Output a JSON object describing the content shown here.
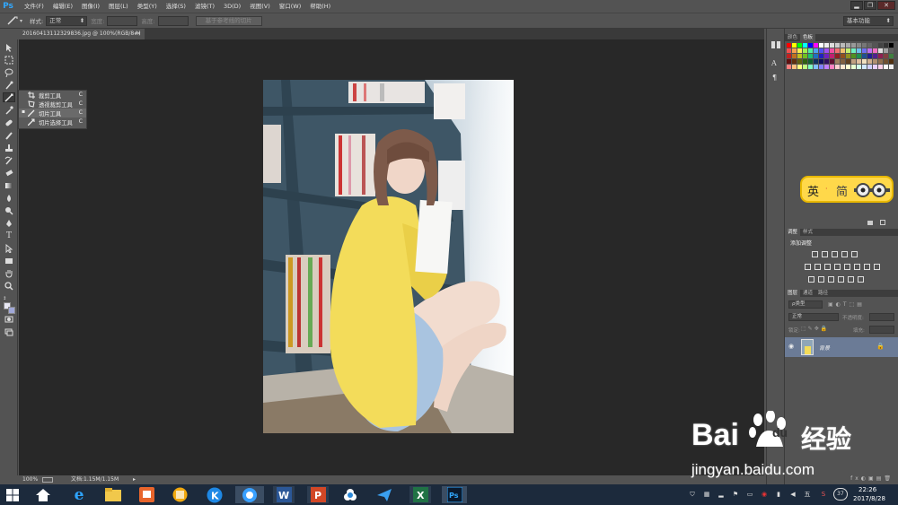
{
  "app": {
    "logo": "Ps"
  },
  "menu": [
    "文件(F)",
    "编辑(E)",
    "图像(I)",
    "图层(L)",
    "类型(Y)",
    "选择(S)",
    "滤镜(T)",
    "3D(D)",
    "视图(V)",
    "窗口(W)",
    "帮助(H)"
  ],
  "window_controls": {
    "minimize": "▂",
    "restore": "❐",
    "close": "✕"
  },
  "options": {
    "style_label": "样式:",
    "style_value": "正常",
    "width_label": "宽度:",
    "height_label": "高度:",
    "guides_button": "基于参考线的切片",
    "workspace": "基本功能"
  },
  "document": {
    "tab_title": "20160413112329836.jpg @ 100%(RGB/8#)",
    "tab_close": "×"
  },
  "flyout": {
    "items": [
      {
        "label": "裁剪工具",
        "key": "C"
      },
      {
        "label": "透视裁剪工具",
        "key": "C"
      },
      {
        "label": "切片工具",
        "key": "C"
      },
      {
        "label": "切片选择工具",
        "key": "C"
      }
    ]
  },
  "status": {
    "zoom": "100%",
    "doc": "文档:1.15M/1.15M"
  },
  "panels": {
    "swatch_tabs": [
      "颜色",
      "色板"
    ],
    "ime": {
      "lang": "英",
      "mode": "简",
      "sep": "·"
    },
    "adjust_tabs": [
      "调整",
      "样式"
    ],
    "adjust_title": "添加调整",
    "layer_tabs": [
      "图层",
      "通道",
      "路径"
    ],
    "filter_kind": "ρ类型",
    "blend_mode": "正常",
    "opacity_label": "不透明度:",
    "lock_label": "锁定:",
    "fill_label": "填充:",
    "layer_name": "背景"
  },
  "taskbar": {
    "clock_time": "22:26",
    "clock_date": "2017/8/28",
    "badge": "37"
  },
  "watermark": {
    "brand_a": "Bai",
    "brand_b": "du",
    "brand_cn": "经验",
    "url": "jingyan.baidu.com"
  },
  "colors": {
    "ps_blue": "#31a8ff",
    "ime_yellow": "#ffd84a",
    "cardigan": "#f3dc5a",
    "taskbar": "#1c2a3c"
  }
}
